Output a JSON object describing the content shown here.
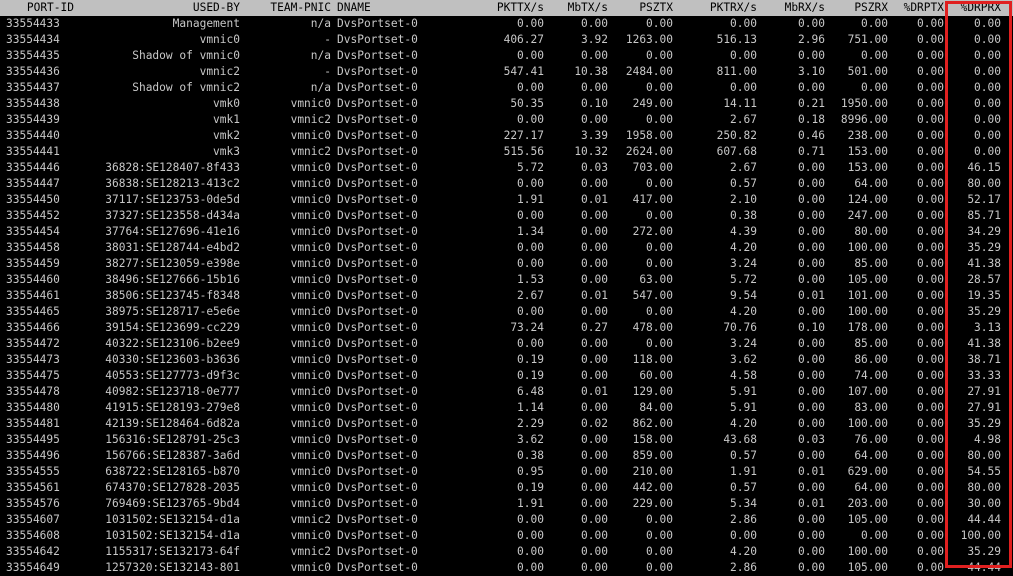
{
  "headers": [
    "PORT-ID",
    "USED-BY",
    "TEAM-PNIC",
    "DNAME",
    "PKTTX/s",
    "MbTX/s",
    "PSZTX",
    "PKTRX/s",
    "MbRX/s",
    "PSZRX",
    "%DRPTX",
    "%DRPRX"
  ],
  "highlight_color": "#e02020",
  "rows": [
    [
      "33554433",
      "Management",
      "n/a",
      "DvsPortset-0",
      "0.00",
      "0.00",
      "0.00",
      "0.00",
      "0.00",
      "0.00",
      "0.00",
      "0.00"
    ],
    [
      "33554434",
      "vmnic0",
      "-",
      "DvsPortset-0",
      "406.27",
      "3.92",
      "1263.00",
      "516.13",
      "2.96",
      "751.00",
      "0.00",
      "0.00"
    ],
    [
      "33554435",
      "Shadow of vmnic0",
      "n/a",
      "DvsPortset-0",
      "0.00",
      "0.00",
      "0.00",
      "0.00",
      "0.00",
      "0.00",
      "0.00",
      "0.00"
    ],
    [
      "33554436",
      "vmnic2",
      "-",
      "DvsPortset-0",
      "547.41",
      "10.38",
      "2484.00",
      "811.00",
      "3.10",
      "501.00",
      "0.00",
      "0.00"
    ],
    [
      "33554437",
      "Shadow of vmnic2",
      "n/a",
      "DvsPortset-0",
      "0.00",
      "0.00",
      "0.00",
      "0.00",
      "0.00",
      "0.00",
      "0.00",
      "0.00"
    ],
    [
      "33554438",
      "vmk0",
      "vmnic0",
      "DvsPortset-0",
      "50.35",
      "0.10",
      "249.00",
      "14.11",
      "0.21",
      "1950.00",
      "0.00",
      "0.00"
    ],
    [
      "33554439",
      "vmk1",
      "vmnic2",
      "DvsPortset-0",
      "0.00",
      "0.00",
      "0.00",
      "2.67",
      "0.18",
      "8996.00",
      "0.00",
      "0.00"
    ],
    [
      "33554440",
      "vmk2",
      "vmnic0",
      "DvsPortset-0",
      "227.17",
      "3.39",
      "1958.00",
      "250.82",
      "0.46",
      "238.00",
      "0.00",
      "0.00"
    ],
    [
      "33554441",
      "vmk3",
      "vmnic2",
      "DvsPortset-0",
      "515.56",
      "10.32",
      "2624.00",
      "607.68",
      "0.71",
      "153.00",
      "0.00",
      "0.00"
    ],
    [
      "33554446",
      "36828:SE128407-8f433",
      "vmnic0",
      "DvsPortset-0",
      "5.72",
      "0.03",
      "703.00",
      "2.67",
      "0.00",
      "153.00",
      "0.00",
      "46.15"
    ],
    [
      "33554447",
      "36838:SE128213-413c2",
      "vmnic0",
      "DvsPortset-0",
      "0.00",
      "0.00",
      "0.00",
      "0.57",
      "0.00",
      "64.00",
      "0.00",
      "80.00"
    ],
    [
      "33554450",
      "37117:SE123753-0de5d",
      "vmnic0",
      "DvsPortset-0",
      "1.91",
      "0.01",
      "417.00",
      "2.10",
      "0.00",
      "124.00",
      "0.00",
      "52.17"
    ],
    [
      "33554452",
      "37327:SE123558-d434a",
      "vmnic0",
      "DvsPortset-0",
      "0.00",
      "0.00",
      "0.00",
      "0.38",
      "0.00",
      "247.00",
      "0.00",
      "85.71"
    ],
    [
      "33554454",
      "37764:SE127696-41e16",
      "vmnic0",
      "DvsPortset-0",
      "1.34",
      "0.00",
      "272.00",
      "4.39",
      "0.00",
      "80.00",
      "0.00",
      "34.29"
    ],
    [
      "33554458",
      "38031:SE128744-e4bd2",
      "vmnic0",
      "DvsPortset-0",
      "0.00",
      "0.00",
      "0.00",
      "4.20",
      "0.00",
      "100.00",
      "0.00",
      "35.29"
    ],
    [
      "33554459",
      "38277:SE123059-e398e",
      "vmnic0",
      "DvsPortset-0",
      "0.00",
      "0.00",
      "0.00",
      "3.24",
      "0.00",
      "85.00",
      "0.00",
      "41.38"
    ],
    [
      "33554460",
      "38496:SE127666-15b16",
      "vmnic0",
      "DvsPortset-0",
      "1.53",
      "0.00",
      "63.00",
      "5.72",
      "0.00",
      "105.00",
      "0.00",
      "28.57"
    ],
    [
      "33554461",
      "38506:SE123745-f8348",
      "vmnic0",
      "DvsPortset-0",
      "2.67",
      "0.01",
      "547.00",
      "9.54",
      "0.01",
      "101.00",
      "0.00",
      "19.35"
    ],
    [
      "33554465",
      "38975:SE128717-e5e6e",
      "vmnic0",
      "DvsPortset-0",
      "0.00",
      "0.00",
      "0.00",
      "4.20",
      "0.00",
      "100.00",
      "0.00",
      "35.29"
    ],
    [
      "33554466",
      "39154:SE123699-cc229",
      "vmnic0",
      "DvsPortset-0",
      "73.24",
      "0.27",
      "478.00",
      "70.76",
      "0.10",
      "178.00",
      "0.00",
      "3.13"
    ],
    [
      "33554472",
      "40322:SE123106-b2ee9",
      "vmnic0",
      "DvsPortset-0",
      "0.00",
      "0.00",
      "0.00",
      "3.24",
      "0.00",
      "85.00",
      "0.00",
      "41.38"
    ],
    [
      "33554473",
      "40330:SE123603-b3636",
      "vmnic0",
      "DvsPortset-0",
      "0.19",
      "0.00",
      "118.00",
      "3.62",
      "0.00",
      "86.00",
      "0.00",
      "38.71"
    ],
    [
      "33554475",
      "40553:SE127773-d9f3c",
      "vmnic0",
      "DvsPortset-0",
      "0.19",
      "0.00",
      "60.00",
      "4.58",
      "0.00",
      "74.00",
      "0.00",
      "33.33"
    ],
    [
      "33554478",
      "40982:SE123718-0e777",
      "vmnic0",
      "DvsPortset-0",
      "6.48",
      "0.01",
      "129.00",
      "5.91",
      "0.00",
      "107.00",
      "0.00",
      "27.91"
    ],
    [
      "33554480",
      "41915:SE128193-279e8",
      "vmnic0",
      "DvsPortset-0",
      "1.14",
      "0.00",
      "84.00",
      "5.91",
      "0.00",
      "83.00",
      "0.00",
      "27.91"
    ],
    [
      "33554481",
      "42139:SE128464-6d82a",
      "vmnic0",
      "DvsPortset-0",
      "2.29",
      "0.02",
      "862.00",
      "4.20",
      "0.00",
      "100.00",
      "0.00",
      "35.29"
    ],
    [
      "33554495",
      "156316:SE128791-25c3",
      "vmnic0",
      "DvsPortset-0",
      "3.62",
      "0.00",
      "158.00",
      "43.68",
      "0.03",
      "76.00",
      "0.00",
      "4.98"
    ],
    [
      "33554496",
      "156766:SE128387-3a6d",
      "vmnic0",
      "DvsPortset-0",
      "0.38",
      "0.00",
      "859.00",
      "0.57",
      "0.00",
      "64.00",
      "0.00",
      "80.00"
    ],
    [
      "33554555",
      "638722:SE128165-b870",
      "vmnic0",
      "DvsPortset-0",
      "0.95",
      "0.00",
      "210.00",
      "1.91",
      "0.01",
      "629.00",
      "0.00",
      "54.55"
    ],
    [
      "33554561",
      "674370:SE127828-2035",
      "vmnic0",
      "DvsPortset-0",
      "0.19",
      "0.00",
      "442.00",
      "0.57",
      "0.00",
      "64.00",
      "0.00",
      "80.00"
    ],
    [
      "33554576",
      "769469:SE123765-9bd4",
      "vmnic0",
      "DvsPortset-0",
      "1.91",
      "0.00",
      "229.00",
      "5.34",
      "0.01",
      "203.00",
      "0.00",
      "30.00"
    ],
    [
      "33554607",
      "1031502:SE132154-d1a",
      "vmnic2",
      "DvsPortset-0",
      "0.00",
      "0.00",
      "0.00",
      "2.86",
      "0.00",
      "105.00",
      "0.00",
      "44.44"
    ],
    [
      "33554608",
      "1031502:SE132154-d1a",
      "vmnic0",
      "DvsPortset-0",
      "0.00",
      "0.00",
      "0.00",
      "0.00",
      "0.00",
      "0.00",
      "0.00",
      "100.00"
    ],
    [
      "33554642",
      "1155317:SE132173-64f",
      "vmnic2",
      "DvsPortset-0",
      "0.00",
      "0.00",
      "0.00",
      "4.20",
      "0.00",
      "100.00",
      "0.00",
      "35.29"
    ],
    [
      "33554649",
      "1257320:SE132143-801",
      "vmnic0",
      "DvsPortset-0",
      "0.00",
      "0.00",
      "0.00",
      "2.86",
      "0.00",
      "105.00",
      "0.00",
      "44.44"
    ]
  ]
}
